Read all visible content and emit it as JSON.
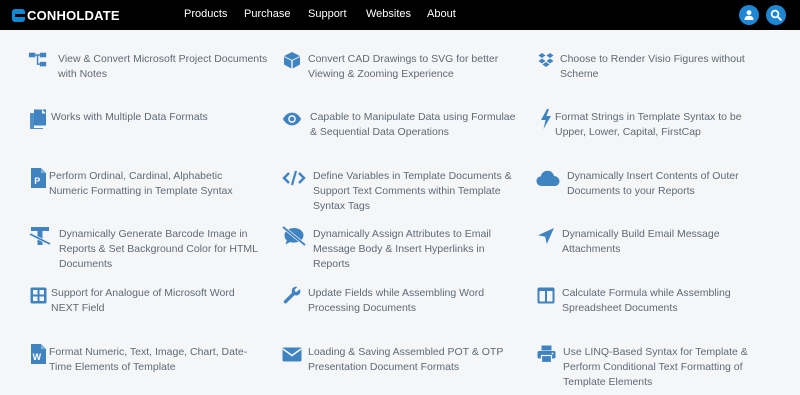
{
  "brand": {
    "name": "CONHOLDATE",
    "accent": "#1f86d3",
    "icon_color": "#3f84c1",
    "text_color": "#5e6a76"
  },
  "nav": {
    "items": [
      "Products",
      "Purchase",
      "Support",
      "Websites",
      "About"
    ],
    "user_icon": "user-icon",
    "search_icon": "search-icon"
  },
  "features": [
    {
      "icon": "project-icon",
      "text": "View & Convert Microsoft Project Documents with Notes"
    },
    {
      "icon": "cube-icon",
      "text": "Convert CAD Drawings to SVG for better Viewing & Zooming Experience"
    },
    {
      "icon": "dropbox-icon",
      "text": "Choose to Render Visio Figures without Scheme"
    },
    {
      "icon": "copy-icon",
      "text": "Works with Multiple Data Formats"
    },
    {
      "icon": "eye-icon",
      "text": "Capable to Manipulate Data using Formulae & Sequential Data Operations"
    },
    {
      "icon": "bolt-icon",
      "text": "Format Strings in Template Syntax to be Upper, Lower, Capital, FirstCap"
    },
    {
      "icon": "powerpoint-file-icon",
      "text": "Perform Ordinal, Cardinal, Alphabetic Numeric Formatting in Template Syntax"
    },
    {
      "icon": "code-icon",
      "text": "Define Variables in Template Documents & Support Text Comments within Template Syntax Tags"
    },
    {
      "icon": "cloud-icon",
      "text": "Dynamically Insert Contents of Outer Documents to your Reports"
    },
    {
      "icon": "text-clear-icon",
      "text": "Dynamically Generate Barcode Image in Reports & Set Background Color for HTML Documents"
    },
    {
      "icon": "comment-slash-icon",
      "text": "Dynamically Assign Attributes to Email Message Body & Insert Hyperlinks in Reports"
    },
    {
      "icon": "location-arrow-icon",
      "text": "Dynamically Build Email Message Attachments"
    },
    {
      "icon": "grid-icon",
      "text": "Support for Analogue of Microsoft Word NEXT Field"
    },
    {
      "icon": "wrench-icon",
      "text": "Update Fields while Assembling Word Processing Documents"
    },
    {
      "icon": "columns-icon",
      "text": "Calculate Formula while Assembling Spreadsheet Documents"
    },
    {
      "icon": "word-file-icon",
      "text": "Format Numeric, Text, Image, Chart, Date-Time Elements of Template"
    },
    {
      "icon": "envelope-icon",
      "text": "Loading & Saving Assembled POT & OTP Presentation Document Formats"
    },
    {
      "icon": "print-icon",
      "text": "Use LINQ-Based Syntax for Template & Perform Conditional Text Formatting of Template Elements"
    }
  ]
}
